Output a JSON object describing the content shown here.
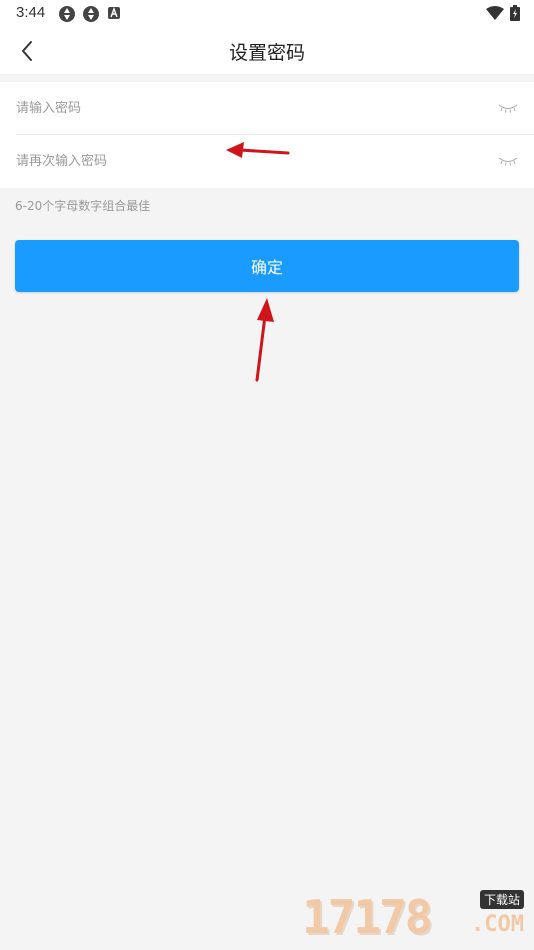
{
  "status_bar": {
    "time": "3:44",
    "left_icons": [
      "aperture-icon",
      "aperture-icon",
      "a-badge-icon"
    ],
    "right_icons": [
      "wifi-icon",
      "battery-charging-icon"
    ]
  },
  "nav": {
    "title": "设置密码",
    "back_icon": "chevron-left-icon"
  },
  "form": {
    "password": {
      "placeholder": "请输入密码",
      "value": "",
      "toggle_icon": "eye-closed-icon"
    },
    "confirm_password": {
      "placeholder": "请再次输入密码",
      "value": "",
      "toggle_icon": "eye-closed-icon"
    }
  },
  "hint": "6-20个字母数字组合最佳",
  "confirm_button": {
    "label": "确定"
  },
  "colors": {
    "accent": "#1a9bff",
    "background": "#f4f4f4",
    "annotation_arrow": "#d0141b"
  },
  "watermark": {
    "digits": "17178",
    "badge": "下载站",
    "suffix": ".COM"
  }
}
